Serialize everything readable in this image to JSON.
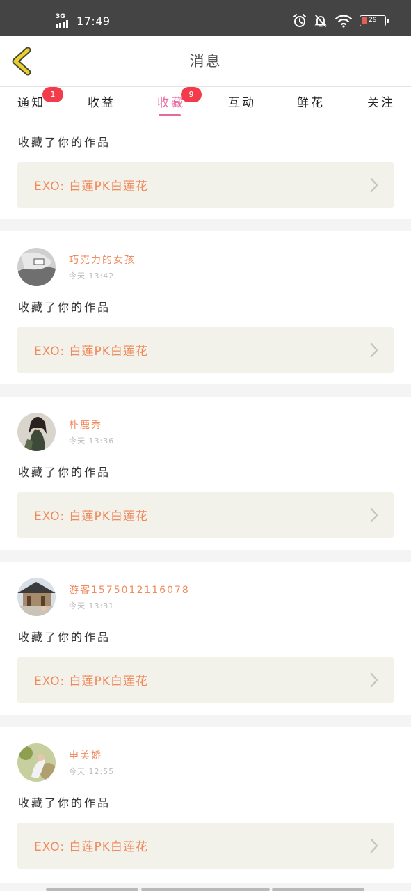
{
  "status_bar": {
    "network": "3G",
    "time": "17:49",
    "battery": "29"
  },
  "header": {
    "title": "消息"
  },
  "tabs": [
    {
      "label": "通知",
      "badge": "1"
    },
    {
      "label": "收益",
      "badge": ""
    },
    {
      "label": "收藏",
      "badge": "9",
      "active": true
    },
    {
      "label": "互动",
      "badge": ""
    },
    {
      "label": "鲜花",
      "badge": ""
    },
    {
      "label": "关注",
      "badge": ""
    }
  ],
  "messages": [
    {
      "user": "",
      "time": "",
      "action": "收藏了你的作品",
      "work": "EXO:   白莲PK白莲花"
    },
    {
      "user": "巧克力的女孩",
      "time": "今天 13:42",
      "action": "收藏了你的作品",
      "work": "EXO:   白莲PK白莲花"
    },
    {
      "user": "朴鹿秀",
      "time": "今天 13:36",
      "action": "收藏了你的作品",
      "work": "EXO:   白莲PK白莲花"
    },
    {
      "user": "游客1575012116078",
      "time": "今天 13:31",
      "action": "收藏了你的作品",
      "work": "EXO:   白莲PK白莲花"
    },
    {
      "user": "申美娇",
      "time": "今天 12:55",
      "action": "收藏了你的作品",
      "work": "EXO:   白莲PK白莲花"
    }
  ],
  "colors": {
    "accent": "#e46aa0",
    "badge": "#f23b4b",
    "username": "#f08a5d",
    "work_bg": "#f3f2ea",
    "back_arrow": "#e8cf3a"
  }
}
